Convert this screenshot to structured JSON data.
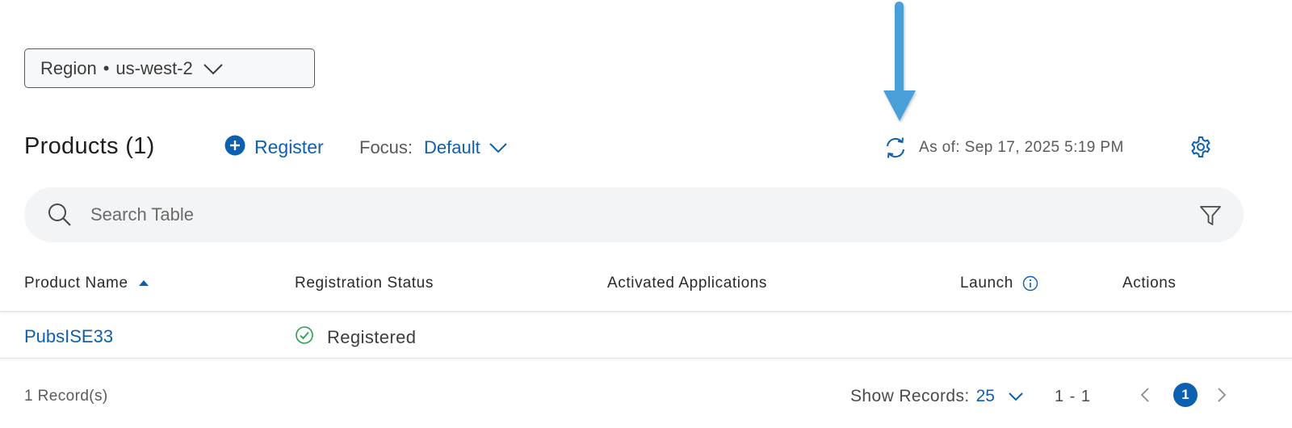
{
  "region": {
    "label": "Region",
    "separator": "•",
    "value": "us-west-2"
  },
  "toolbar": {
    "title": "Products (1)",
    "register_label": "Register",
    "focus_label": "Focus:",
    "focus_value": "Default",
    "as_of": "As of: Sep 17, 2025 5:19 PM"
  },
  "search": {
    "placeholder": "Search Table",
    "value": ""
  },
  "table": {
    "columns": [
      "Product Name",
      "Registration Status",
      "Activated Applications",
      "Launch",
      "Actions"
    ],
    "sort": {
      "column": "Product Name",
      "direction": "ascending"
    },
    "rows": [
      {
        "product_name": "PubsISE33",
        "registration_status": "Registered",
        "activated_applications": "",
        "launch": "",
        "actions": ""
      }
    ]
  },
  "footer": {
    "record_count": "1 Record(s)",
    "show_records_label": "Show Records:",
    "show_records_value": "25",
    "range": "1 - 1",
    "current_page": "1"
  },
  "icons": {
    "region_chevron": "chevron-down-icon",
    "register": "plus-circle-icon",
    "focus_chevron": "chevron-down-icon",
    "refresh": "refresh-icon",
    "settings": "gear-icon",
    "search": "search-icon",
    "filter": "filter-icon",
    "sort": "sort-ascending-icon",
    "launch_info": "info-icon",
    "status_ok": "check-circle-icon",
    "records_chevron": "chevron-down-icon",
    "prev": "chevron-left-icon",
    "next": "chevron-right-icon",
    "annotation_arrow": "arrow-down-icon"
  },
  "colors": {
    "accent": "#0d5fb0",
    "annotation_arrow": "#4a9fd8",
    "success": "#2e9e4f",
    "search_bg": "#f3f4f5"
  }
}
